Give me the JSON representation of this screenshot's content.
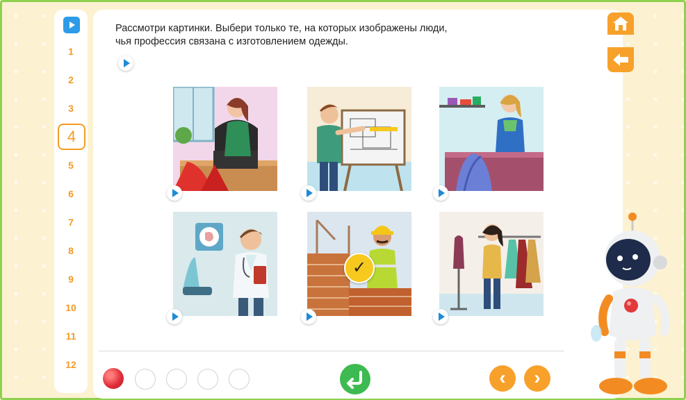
{
  "question": {
    "line1": "Рассмотри картинки. Выбери только те, на которых изображены люди,",
    "line2": "чья профессия связана с изготовлением одежды."
  },
  "nav": {
    "numbers": [
      "1",
      "2",
      "3",
      "4",
      "5",
      "6",
      "7",
      "8",
      "9",
      "10",
      "11",
      "12"
    ],
    "current": "4"
  },
  "cards": [
    {
      "name": "seamstress",
      "selected": false
    },
    {
      "name": "architect",
      "selected": false
    },
    {
      "name": "tailor",
      "selected": false
    },
    {
      "name": "doctor",
      "selected": false
    },
    {
      "name": "builder",
      "selected": true
    },
    {
      "name": "fashion-designer",
      "selected": false
    }
  ],
  "progress": {
    "total": 5,
    "completed": 1
  },
  "footer": {
    "prev": "‹",
    "next": "›"
  },
  "colors": {
    "accent": "#f7a12b",
    "confirm": "#3dba51",
    "link": "#2d9be8",
    "frame": "#8fd14f",
    "numbers": "#f39b23"
  }
}
